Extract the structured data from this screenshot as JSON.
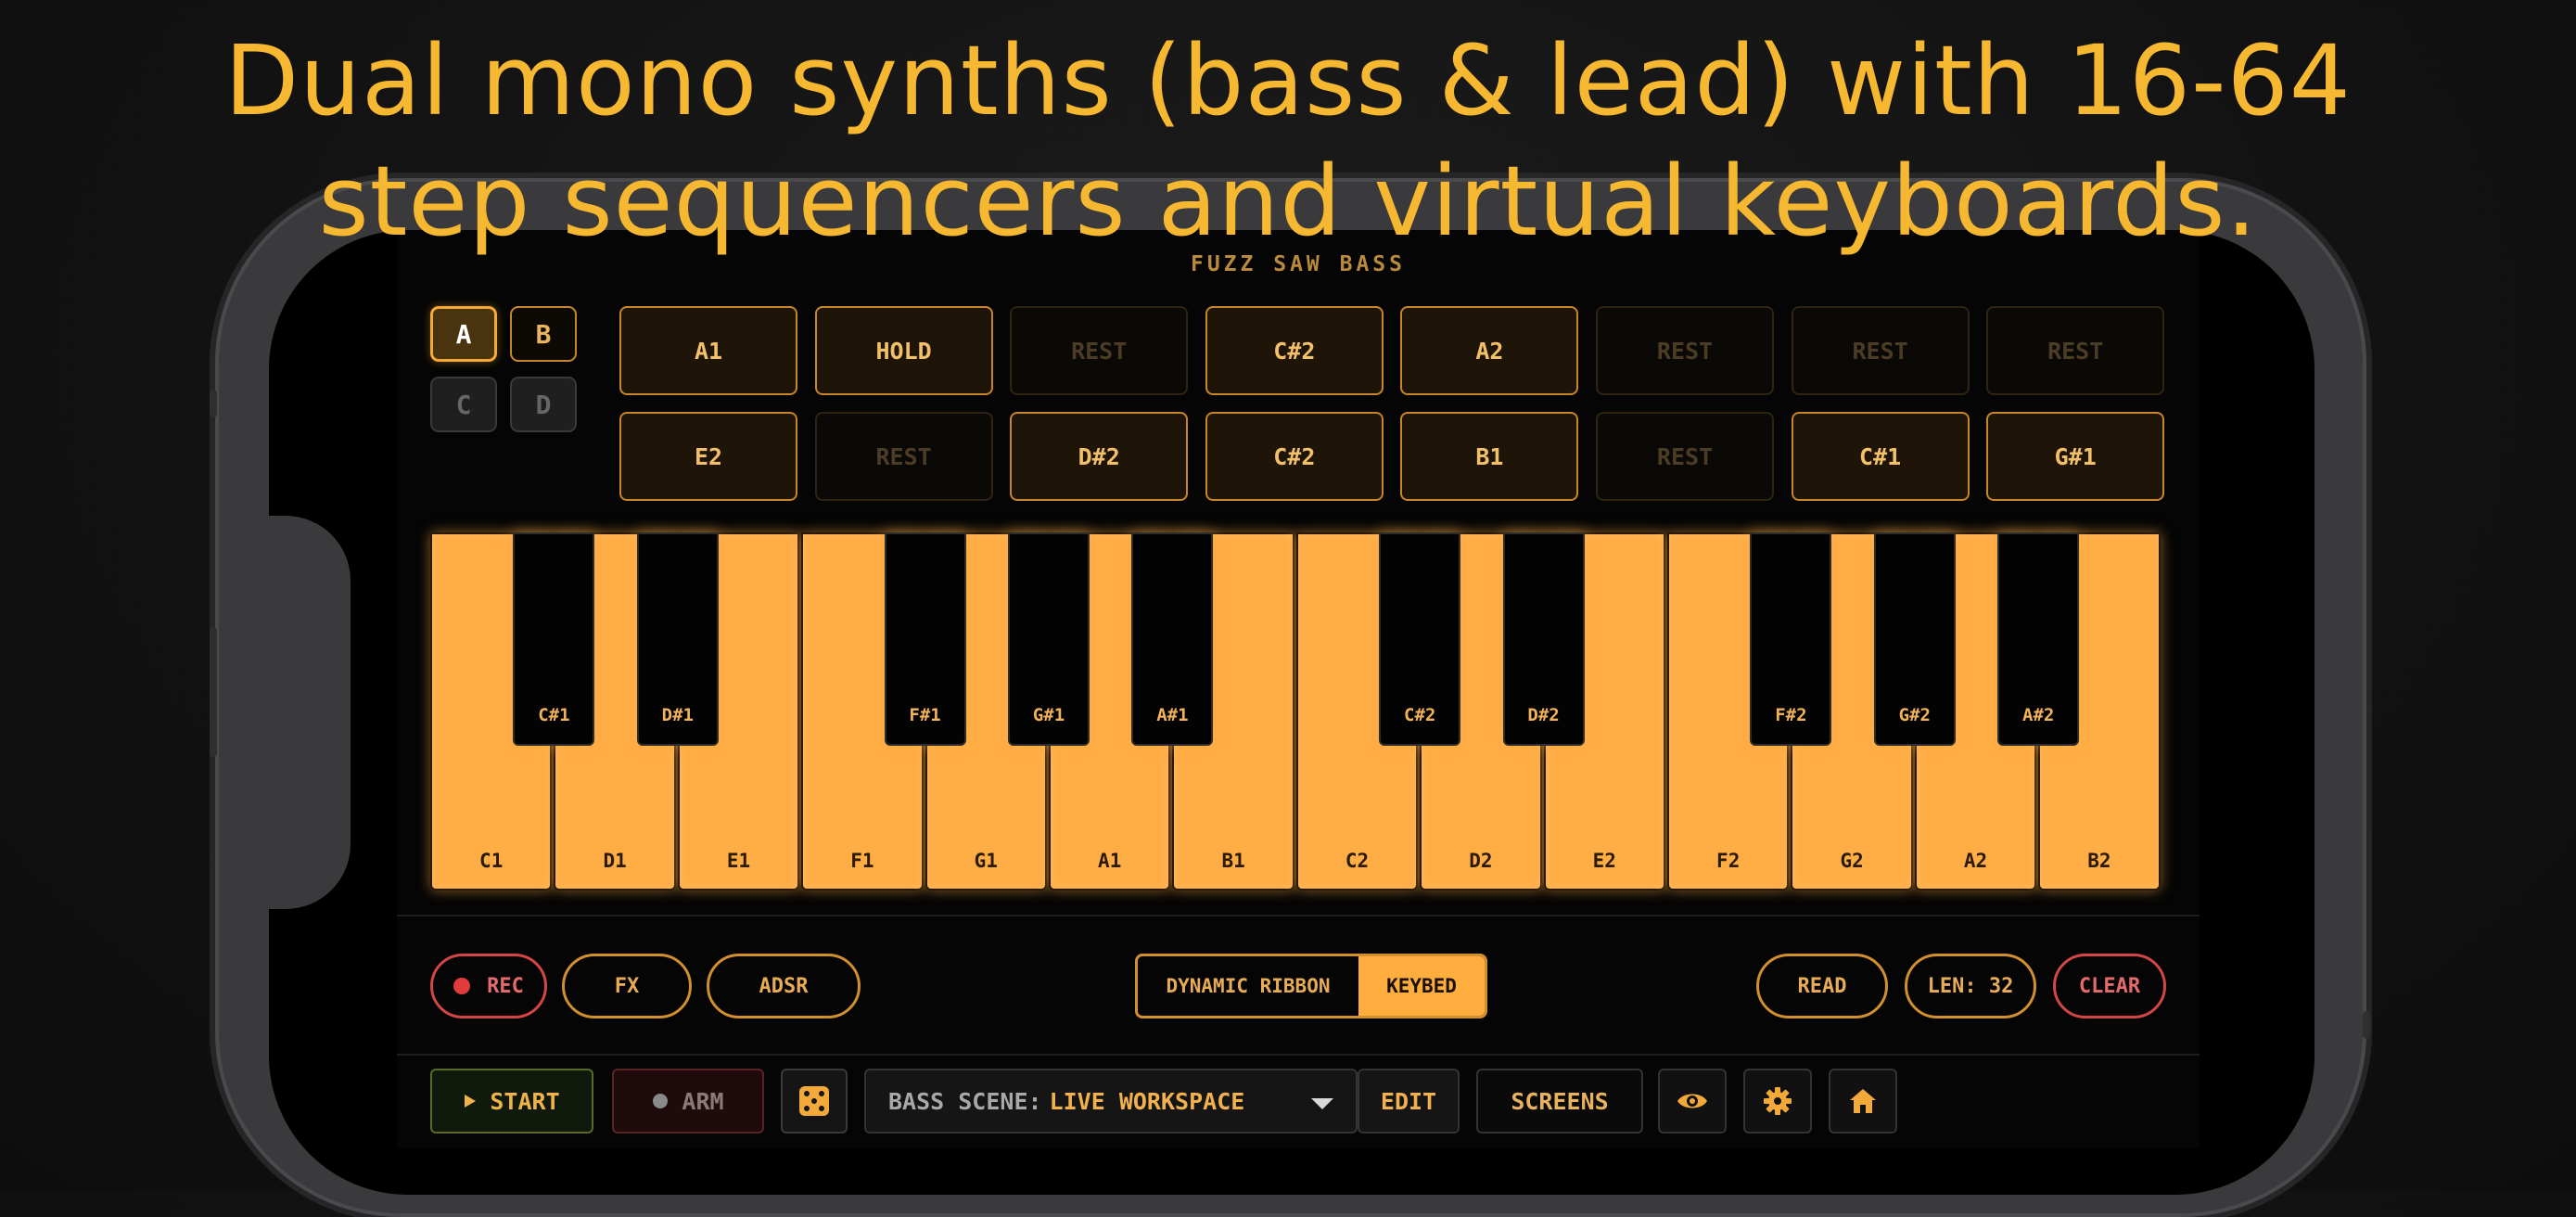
{
  "headline": {
    "line1": "Dual mono synths (bass & lead) with 16-64",
    "line2": "step sequencers and virtual keyboards."
  },
  "app": {
    "preset_name": "FUZZ SAW BASS",
    "patterns": [
      {
        "label": "A",
        "state": "active"
      },
      {
        "label": "B",
        "state": "available"
      },
      {
        "label": "C",
        "state": "disabled"
      },
      {
        "label": "D",
        "state": "disabled"
      }
    ],
    "steps_row1": [
      {
        "label": "A1",
        "rest": false
      },
      {
        "label": "HOLD",
        "rest": false
      },
      {
        "label": "REST",
        "rest": true
      },
      {
        "label": "C#2",
        "rest": false
      },
      {
        "label": "A2",
        "rest": false
      },
      {
        "label": "REST",
        "rest": true
      },
      {
        "label": "REST",
        "rest": true
      },
      {
        "label": "REST",
        "rest": true
      }
    ],
    "steps_row2": [
      {
        "label": "E2",
        "rest": false
      },
      {
        "label": "REST",
        "rest": true
      },
      {
        "label": "D#2",
        "rest": false
      },
      {
        "label": "C#2",
        "rest": false
      },
      {
        "label": "B1",
        "rest": false
      },
      {
        "label": "REST",
        "rest": true
      },
      {
        "label": "C#1",
        "rest": false
      },
      {
        "label": "G#1",
        "rest": false
      }
    ],
    "white_keys": [
      "C1",
      "D1",
      "E1",
      "F1",
      "G1",
      "A1",
      "B1",
      "C2",
      "D2",
      "E2",
      "F2",
      "G2",
      "A2",
      "B2"
    ],
    "black_keys": [
      {
        "label": "C#1",
        "after": 0
      },
      {
        "label": "D#1",
        "after": 1
      },
      {
        "label": "F#1",
        "after": 3
      },
      {
        "label": "G#1",
        "after": 4
      },
      {
        "label": "A#1",
        "after": 5
      },
      {
        "label": "C#2",
        "after": 7
      },
      {
        "label": "D#2",
        "after": 8
      },
      {
        "label": "F#2",
        "after": 10
      },
      {
        "label": "G#2",
        "after": 11
      },
      {
        "label": "A#2",
        "after": 12
      }
    ],
    "controls": {
      "rec": "REC",
      "fx": "FX",
      "adsr": "ADSR",
      "mode_ribbon": "DYNAMIC RIBBON",
      "mode_keybed": "KEYBED",
      "mode_selected": "KEYBED",
      "read": "READ",
      "length": "LEN: 32",
      "clear": "CLEAR"
    },
    "bottom": {
      "start": "START",
      "arm": "ARM",
      "scene_label": "BASS SCENE:",
      "scene_value": "LIVE WORKSPACE",
      "edit": "EDIT",
      "screens": "SCREENS"
    },
    "colors": {
      "accent": "#ffad45",
      "headline": "#f6b731",
      "rec_red": "#e23b3b"
    },
    "icons": [
      "play-icon",
      "record-dot-icon",
      "dice-icon",
      "chevron-down-icon",
      "eye-icon",
      "gear-icon",
      "home-icon"
    ]
  }
}
